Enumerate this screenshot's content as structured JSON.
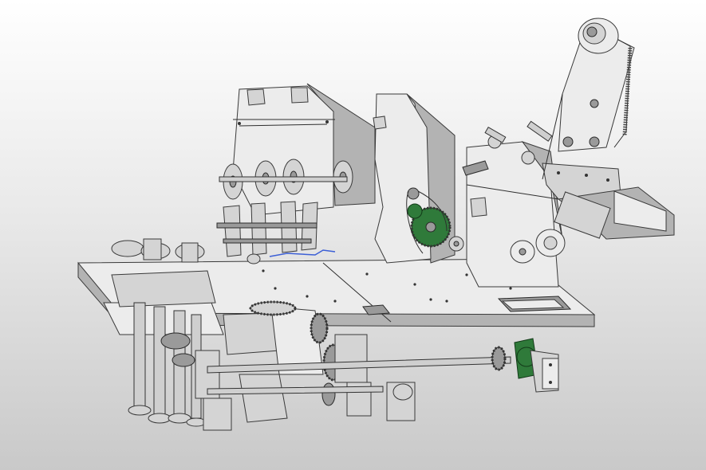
{
  "viewport": {
    "background_top": "#ffffff",
    "background_bottom": "#c9c9c9",
    "selection_highlight_color": "#3c5fd6",
    "accent_part_color": "#2f7a3a"
  }
}
